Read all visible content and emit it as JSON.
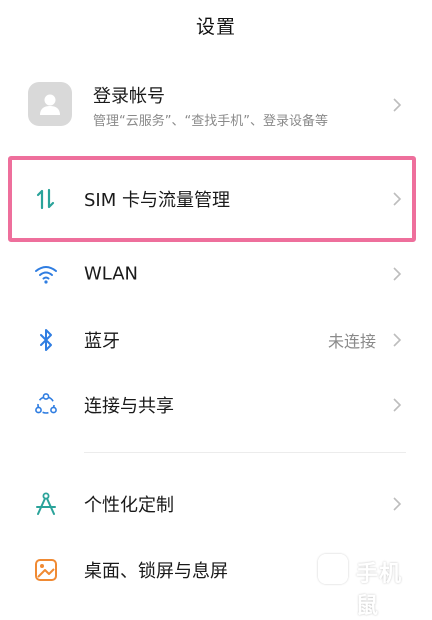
{
  "header": {
    "title": "设置"
  },
  "account": {
    "title": "登录帐号",
    "subtitle": "管理“云服务”、“查找手机”、登录设备等"
  },
  "rows": [
    {
      "label": "SIM 卡与流量管理",
      "value": ""
    },
    {
      "label": "WLAN",
      "value": ""
    },
    {
      "label": "蓝牙",
      "value": "未连接"
    },
    {
      "label": "连接与共享",
      "value": ""
    },
    {
      "label": "个性化定制",
      "value": ""
    },
    {
      "label": "桌面、锁屏与息屏",
      "value": ""
    }
  ],
  "watermark": {
    "text": "手机鼠"
  },
  "colors": {
    "highlight": "#ee6f9c",
    "icon_teal": "#2aa39a",
    "icon_blue": "#2f7de1",
    "icon_orange": "#f08a33"
  }
}
